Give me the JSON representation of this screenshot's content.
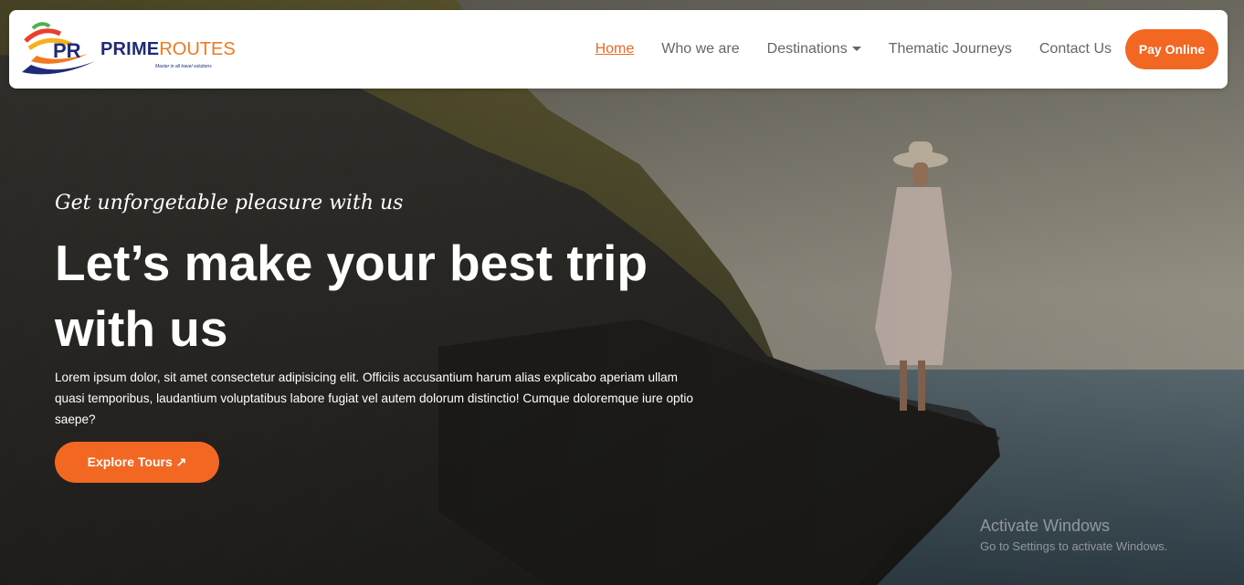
{
  "brand": {
    "name_part1": "PRIME",
    "name_part2": "ROUTES",
    "tagline": "Master in all travel solutions"
  },
  "nav": {
    "items": [
      {
        "label": "Home",
        "active": true
      },
      {
        "label": "Who we are",
        "active": false
      },
      {
        "label": "Destinations",
        "active": false,
        "dropdown": true
      },
      {
        "label": "Thematic Journeys",
        "active": false
      },
      {
        "label": "Contact Us",
        "active": false
      }
    ],
    "pay_label": "Pay Online"
  },
  "hero": {
    "tagline": "Get unforgetable pleasure with us",
    "headline": "Let’s make your best trip with us",
    "description": "Lorem ipsum dolor, sit amet consectetur adipisicing elit. Officiis accusantium harum alias explicabo aperiam ullam quasi temporibus, laudantium voluptatibus labore fugiat vel autem dolorum distinctio! Cumque doloremque iure optio saepe?",
    "cta_label": "Explore Tours ↗"
  },
  "watermark": {
    "title": "Activate Windows",
    "subtitle": "Go to Settings to activate Windows."
  },
  "colors": {
    "accent": "#f26722",
    "brand_blue": "#1f2a7a",
    "nav_text": "#666666"
  }
}
